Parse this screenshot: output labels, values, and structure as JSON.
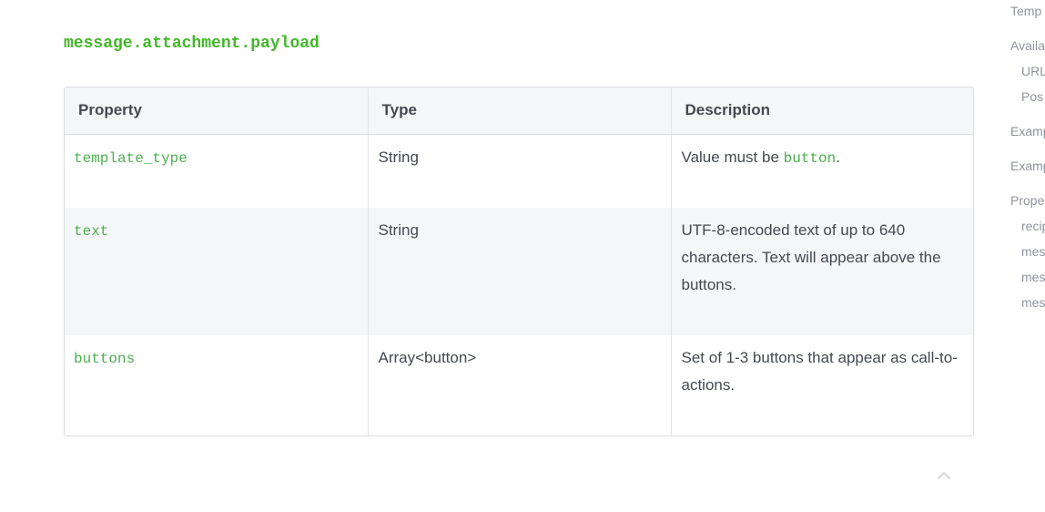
{
  "section": {
    "heading": "message.attachment.payload"
  },
  "table": {
    "headers": [
      "Property",
      "Type",
      "Description"
    ],
    "rows": [
      {
        "property": "template_type",
        "type": "String",
        "desc_prefix": "Value must be ",
        "desc_code": "button",
        "desc_suffix": "."
      },
      {
        "property": "text",
        "type": "String",
        "description": "UTF-8-encoded text of up to 640 characters. Text will appear above the buttons."
      },
      {
        "property": "buttons",
        "type": "Array<button>",
        "description": "Set of 1-3 buttons that appear as call-to-actions."
      }
    ]
  },
  "toc": {
    "items": [
      "Temp",
      "Availa",
      "URL",
      "Pos",
      "Examp",
      "Examp",
      "Prope",
      "recip",
      "mes",
      "mes",
      "mes"
    ]
  },
  "icons": {
    "scroll_top": "chevron-up-icon"
  },
  "colors": {
    "accent": "#42b72a",
    "code": "#4caf50",
    "header_bg": "#f5f6f7",
    "border": "#dadde1"
  }
}
